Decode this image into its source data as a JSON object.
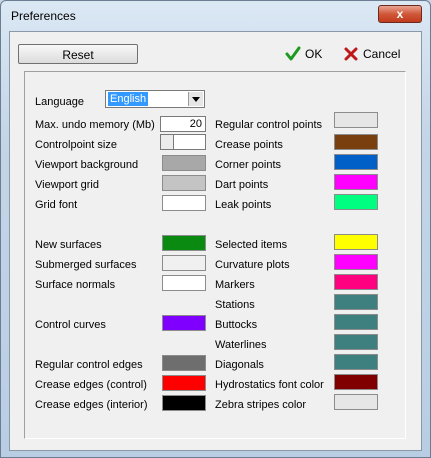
{
  "window": {
    "title": "Preferences",
    "close_glyph": "x"
  },
  "toolbar": {
    "reset_label": "Reset",
    "ok_label": "OK",
    "cancel_label": "Cancel"
  },
  "settings": {
    "language_label": "Language",
    "language_value": "English",
    "undo_label": "Max. undo memory (Mb)",
    "undo_value": "20",
    "cp_size_label": "Controlpoint size"
  },
  "left_colors": [
    {
      "label": "Viewport background",
      "color": "#a8a8a8"
    },
    {
      "label": "Viewport grid",
      "color": "#c4c4c4"
    },
    {
      "label": "Grid font",
      "color": "#ffffff"
    },
    {
      "label": "New surfaces",
      "color": "#0a8a10"
    },
    {
      "label": "Submerged surfaces",
      "color": "#f0f0f0"
    },
    {
      "label": "Surface normals",
      "color": "#ffffff"
    },
    {
      "label": "Control curves",
      "color": "#7f00ff"
    },
    {
      "label": "Regular control edges",
      "color": "#6e6e6e"
    },
    {
      "label": "Crease edges (control)",
      "color": "#ff0000"
    },
    {
      "label": "Crease edges (interior)",
      "color": "#000000"
    }
  ],
  "right_colors": [
    {
      "label": "Regular control points",
      "color": "#e6e6e6"
    },
    {
      "label": "Crease points",
      "color": "#7a3f0f"
    },
    {
      "label": "Corner points",
      "color": "#0060c8"
    },
    {
      "label": "Dart points",
      "color": "#ff00ff"
    },
    {
      "label": "Leak points",
      "color": "#00ff80"
    },
    {
      "label": "Selected items",
      "color": "#ffff00"
    },
    {
      "label": "Curvature plots",
      "color": "#ff00ff"
    },
    {
      "label": "Markers",
      "color": "#ff0080"
    },
    {
      "label": "Stations",
      "color": "#3e7f7f"
    },
    {
      "label": "Buttocks",
      "color": "#3e7f7f"
    },
    {
      "label": "Waterlines",
      "color": "#3e7f7f"
    },
    {
      "label": "Diagonals",
      "color": "#3e7f7f"
    },
    {
      "label": "Hydrostatics font color",
      "color": "#800000"
    },
    {
      "label": "Zebra stripes color",
      "color": "#e6e6e6"
    }
  ]
}
